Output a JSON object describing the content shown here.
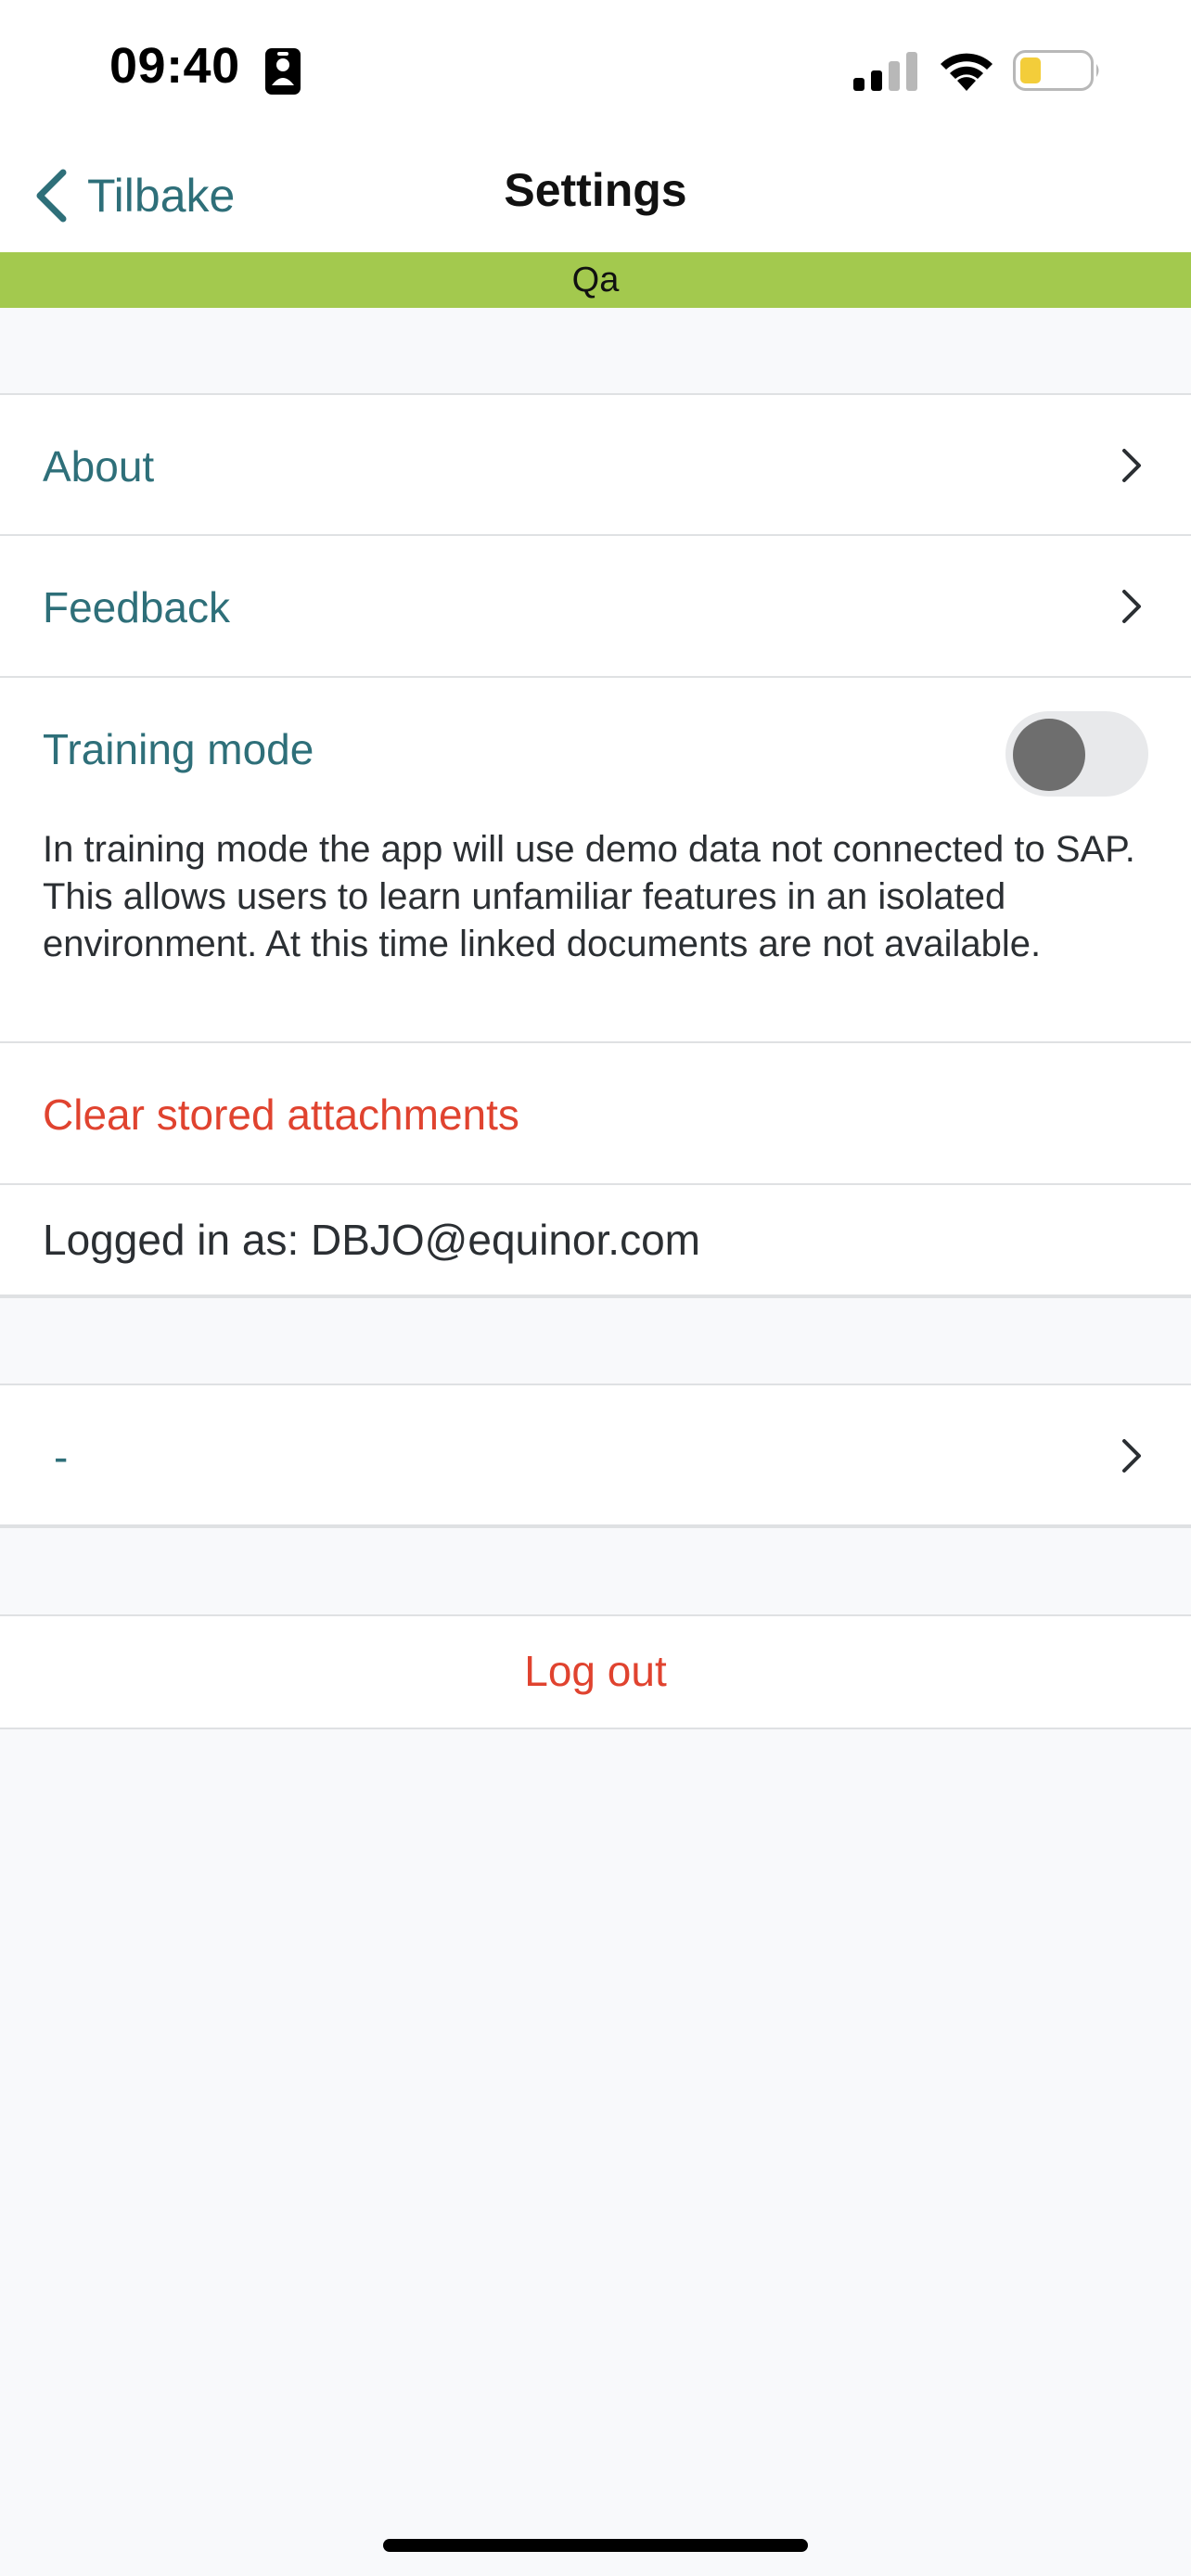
{
  "status_bar": {
    "time": "09:40",
    "icons": [
      "id-card-icon",
      "cellular-signal-icon",
      "wifi-icon",
      "battery-icon"
    ],
    "battery_color": "#f3cd3a"
  },
  "nav": {
    "back_label": "Tilbake",
    "title": "Settings"
  },
  "environment_banner": {
    "label": "Qa",
    "color": "#a3c94e"
  },
  "settings": {
    "about_label": "About",
    "feedback_label": "Feedback",
    "training_mode": {
      "label": "Training mode",
      "enabled": false,
      "description": "In training mode the app will use demo data not connected to SAP. This allows users to learn unfamiliar features in an isolated environment. At this time linked documents are not available."
    },
    "clear_attachments_label": "Clear stored attachments",
    "logged_in_as": "Logged in as: DBJO@equinor.com"
  },
  "plant_row": {
    "label": "-"
  },
  "logout_label": "Log out",
  "colors": {
    "accent_teal": "#2e6f79",
    "destructive_red": "#e0432f",
    "background": "#f8f9fb"
  }
}
